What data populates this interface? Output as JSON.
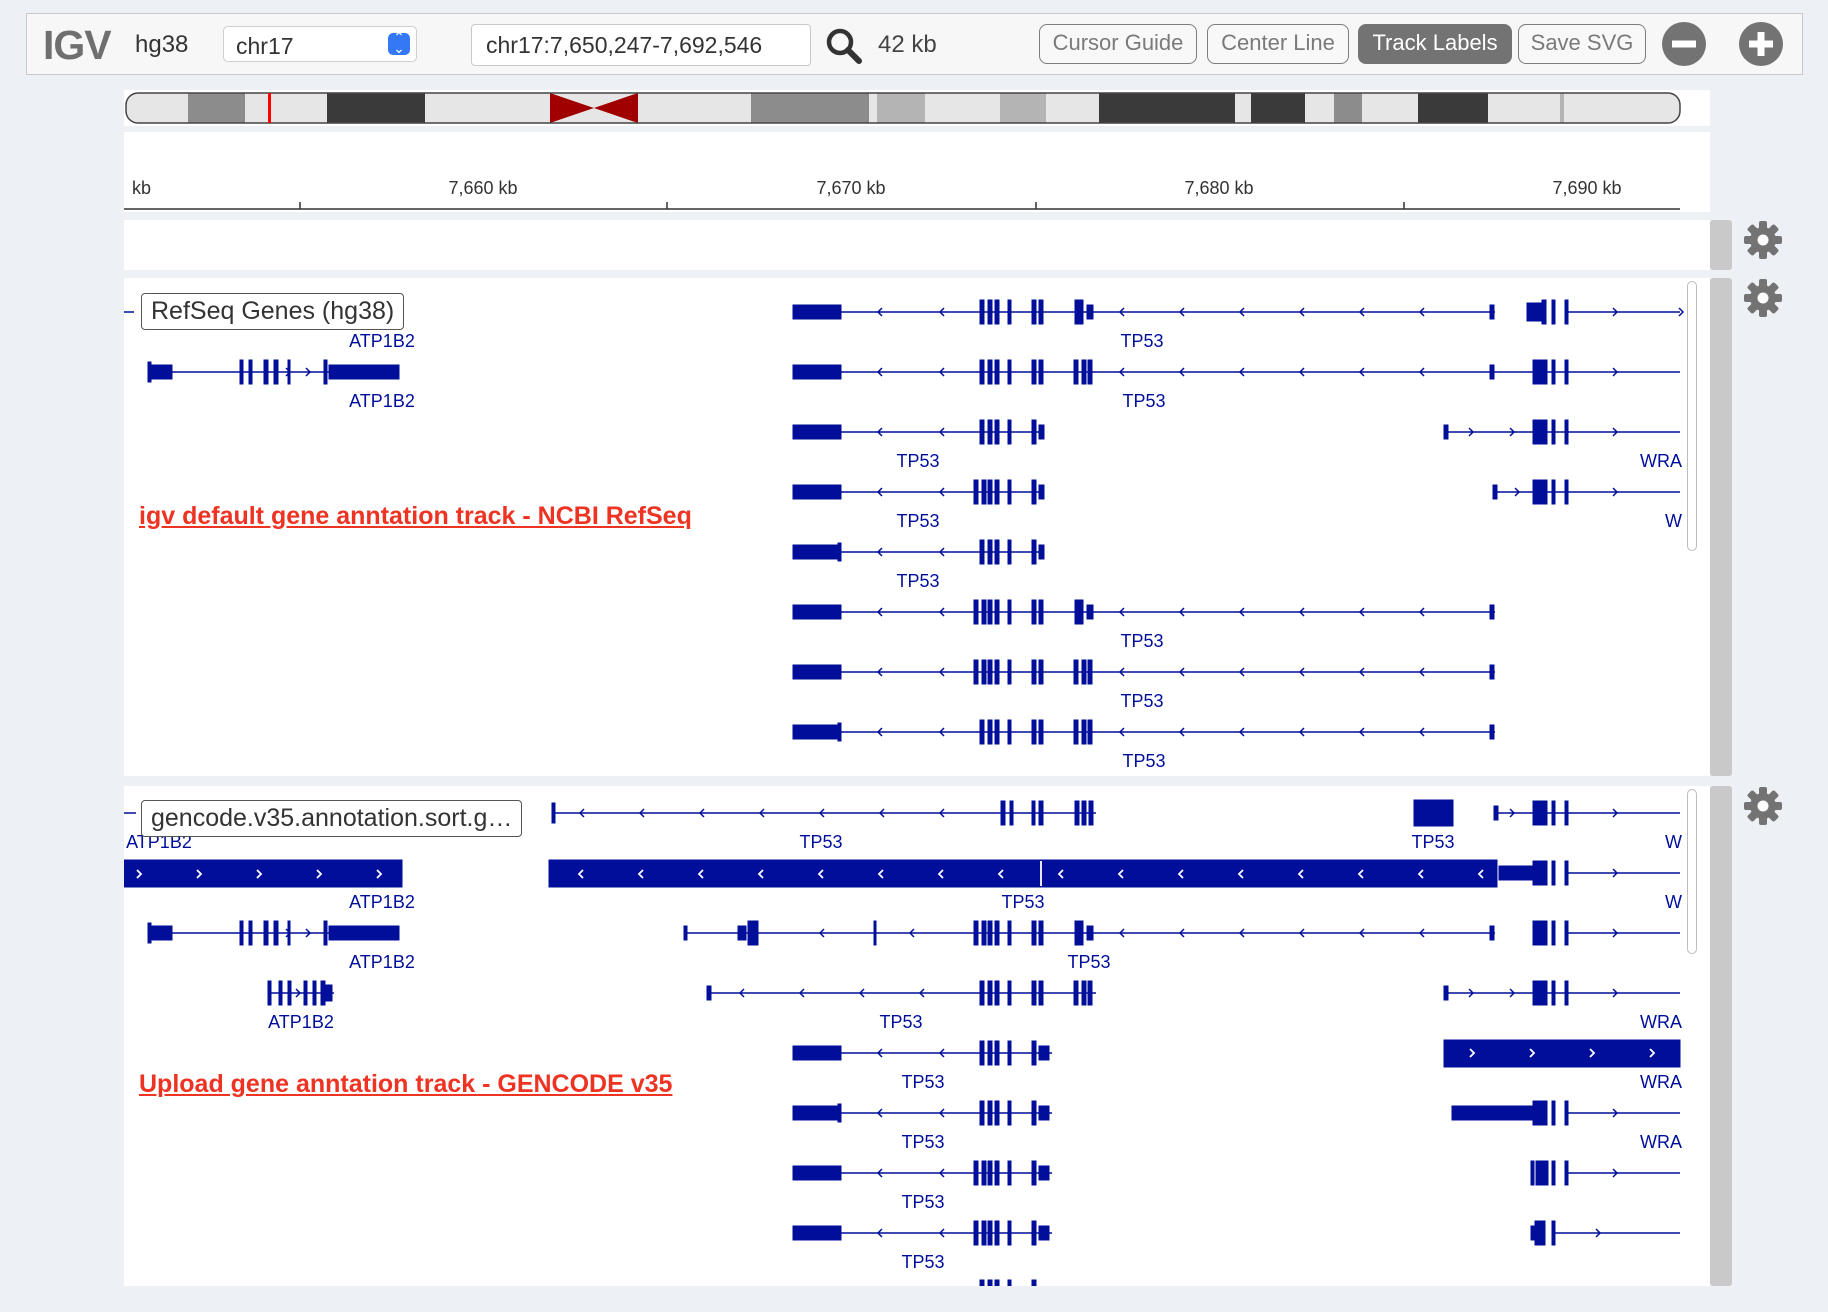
{
  "navbar": {
    "logo": "IGV",
    "genome": "hg38",
    "chromosome": "chr17",
    "locus": "chr17:7,650,247-7,692,546",
    "window_size": "42 kb",
    "buttons": {
      "cursor_guide": "Cursor Guide",
      "center_line": "Center Line",
      "track_labels": "Track Labels",
      "save_svg": "Save SVG"
    }
  },
  "ruler": {
    "ticks": [
      "kb",
      "7,660 kb",
      "7,670 kb",
      "7,680 kb",
      "7,690 kb"
    ]
  },
  "tracks": [
    {
      "label": "RefSeq Genes (hg38)",
      "annotation": "igv default gene anntation track - NCBI RefSeq",
      "features": [
        "ATP1B2",
        "TP53",
        "ATP1B2",
        "TP53",
        "TP53",
        "WRA",
        "TP53",
        "W",
        "TP53",
        "TP53",
        "TP53",
        "TP53"
      ]
    },
    {
      "label": "gencode.v35.annotation.sort.g…",
      "annotation": "Upload gene anntation track - GENCODE v35",
      "features": [
        "ATP1B2",
        "TP53",
        "TP53",
        "W",
        "ATP1B2",
        "TP53",
        "W",
        "ATP1B2",
        "TP53",
        "ATP1B2",
        "TP53",
        "WRA",
        "TP53",
        "WRA",
        "TP53",
        "WRA",
        "TP53",
        "TP53"
      ]
    }
  ],
  "colors": {
    "feature": "#000e9a",
    "annotation": "#ee3322",
    "centromere": "#a00000"
  }
}
